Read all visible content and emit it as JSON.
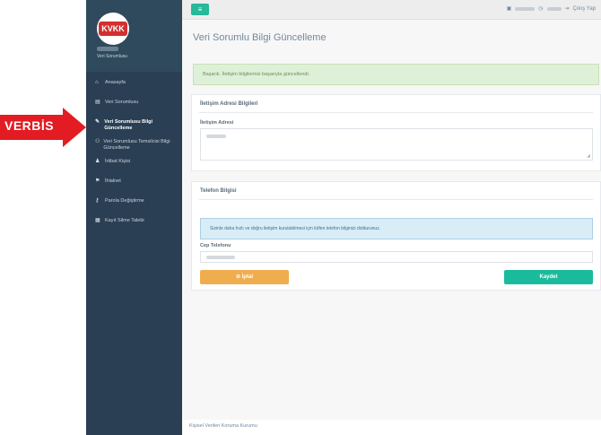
{
  "annotation": {
    "label": "VERBİS"
  },
  "sidebar": {
    "logo_text": "KVKK",
    "role": "Veri Sorumlusu",
    "items": [
      {
        "icon": "⌂",
        "label": "Anasayfa"
      },
      {
        "icon": "▤",
        "label": "Veri Sorumlusu"
      },
      {
        "icon": "✎",
        "label": "Veri Sorumlusu Bilgi Güncelleme"
      },
      {
        "icon": "⚇",
        "label": "Veri Sorumlusu Temsilcisi Bilgi Güncelleme"
      },
      {
        "icon": "♟",
        "label": "İrtibat Kişisi"
      },
      {
        "icon": "⚑",
        "label": "İhlalnet"
      },
      {
        "icon": "⚷",
        "label": "Parola Değiştirme"
      },
      {
        "icon": "▦",
        "label": "Kayıt Silme Talebi"
      }
    ],
    "active_index": 2
  },
  "topbar": {
    "toggle_icon": "≡",
    "calendar_icon": "▣",
    "clock_icon": "◷",
    "logout_icon": "⇥",
    "logout_label": "Çıkış Yap"
  },
  "main": {
    "title": "Veri Sorumlu Bilgi Güncelleme",
    "success_message": "Başarılı. İletişim bilgileriniz başarıyla güncellendi.",
    "address_panel": {
      "title": "İletişim Adresi Bilgileri",
      "field_label": "İletişim Adresi"
    },
    "phone_panel": {
      "title": "Telefon Bilgisi",
      "info_message": "Sizinle daha hızlı ve doğru iletişim kurulabilmesi için lütfen telefon bilginizi doldurunuz.",
      "field_label": "Cep Telefonu",
      "cancel_label": "İptal",
      "cancel_icon": "⊘",
      "save_label": "Kaydet"
    }
  },
  "footer": {
    "text": "Kişisel Verileri Koruma Kurumu"
  }
}
